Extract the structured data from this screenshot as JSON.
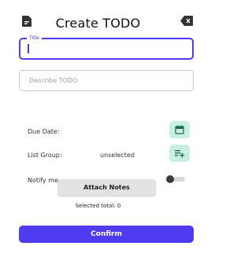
{
  "header": {
    "title": "Create TODO",
    "left_icon": "document-icon",
    "right_icon": "backspace-icon"
  },
  "form": {
    "title_field": {
      "label": "Title",
      "value": ""
    },
    "description_field": {
      "placeholder": "Describe TODO",
      "value": ""
    },
    "due_date": {
      "label": "Due Date:",
      "icon": "calendar-icon"
    },
    "list_group": {
      "label": "List Group:",
      "value": "unselected",
      "icon": "playlist-add-icon"
    },
    "notify": {
      "label": "Notify me:",
      "enabled": false
    },
    "attach_notes_label": "Attach Notes",
    "selected_total": "Selected total: 0",
    "confirm_label": "Confirm"
  },
  "colors": {
    "accent": "#4f3bf2",
    "icon_button_bg": "#c8efe2",
    "icon_color": "#1e6e4e"
  }
}
